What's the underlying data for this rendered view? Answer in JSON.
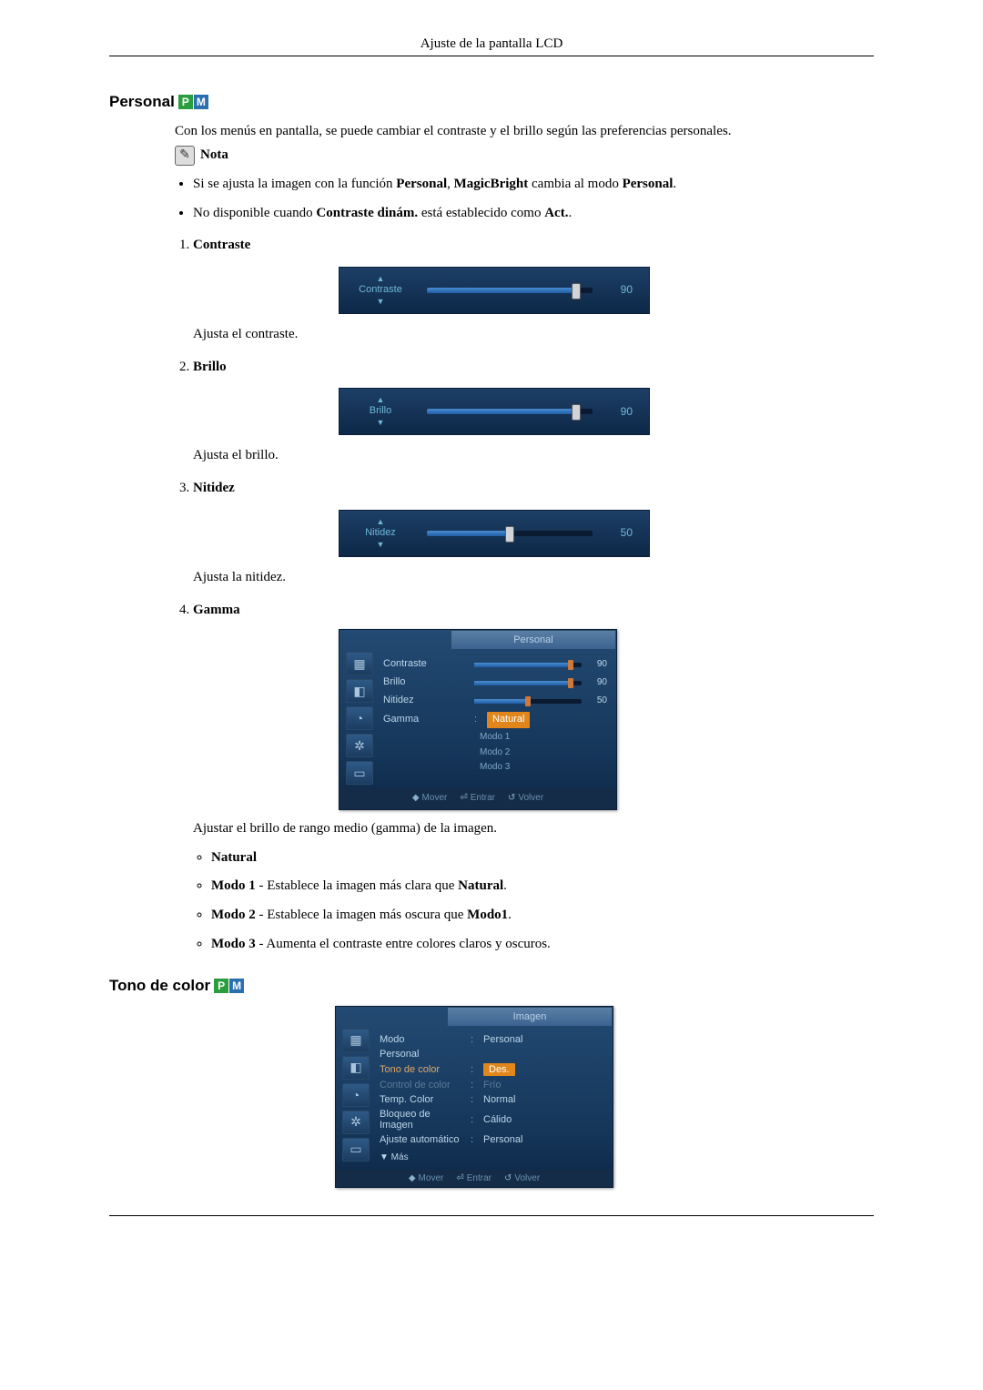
{
  "page_header": "Ajuste de la pantalla LCD",
  "pm_badge": {
    "p": "P",
    "m": "M"
  },
  "personal": {
    "title": "Personal",
    "intro": "Con los menús en pantalla, se puede cambiar el contraste y el brillo según las preferencias personales.",
    "note_label": "Nota",
    "bullet1": {
      "p1": "Si se ajusta la imagen con la función ",
      "b1": "Personal",
      "p2": ", ",
      "b2": "MagicBright",
      "p3": " cambia al modo ",
      "b3": "Personal",
      "p4": "."
    },
    "bullet2": {
      "p1": "No disponible cuando ",
      "b1": "Contraste dinám.",
      "p2": " está establecido como ",
      "b2": "Act.",
      "p3": "."
    },
    "items": [
      {
        "title": "Contraste",
        "slider_label": "Contraste",
        "value": 90,
        "fill_pct": 90,
        "desc": "Ajusta el contraste."
      },
      {
        "title": "Brillo",
        "slider_label": "Brillo",
        "value": 90,
        "fill_pct": 90,
        "desc": "Ajusta el brillo."
      },
      {
        "title": "Nitidez",
        "slider_label": "Nitidez",
        "value": 50,
        "fill_pct": 50,
        "desc": "Ajusta la nitidez."
      },
      {
        "title": "Gamma",
        "desc": "Ajustar el brillo de rango medio (gamma) de la imagen."
      }
    ],
    "gamma_menu": {
      "tab": "Personal",
      "rows": [
        {
          "label": "Contraste",
          "value": 90
        },
        {
          "label": "Brillo",
          "value": 90
        },
        {
          "label": "Nitidez",
          "value": 50
        }
      ],
      "gamma_label": "Gamma",
      "options": [
        "Natural",
        "Modo 1",
        "Modo 2",
        "Modo 3"
      ],
      "selected": "Natural",
      "footer": {
        "move": "Mover",
        "enter": "Entrar",
        "return": "Volver"
      }
    },
    "gamma_bullets": {
      "natural": "Natural",
      "m1": {
        "b": "Modo 1",
        "t1": " - Establece la imagen más clara que ",
        "b2": "Natural",
        "t2": "."
      },
      "m2": {
        "b": "Modo 2",
        "t1": " - Establece la imagen más oscura que ",
        "b2": "Modo1",
        "t2": "."
      },
      "m3": {
        "b": "Modo 3",
        "t": " - Aumenta el contraste entre colores claros y oscuros."
      }
    }
  },
  "tono": {
    "title": "Tono de color",
    "menu": {
      "tab": "Imagen",
      "rows": [
        {
          "label": "Modo",
          "value": "Personal"
        },
        {
          "label": "Personal"
        },
        {
          "label": "Tono de color",
          "highlight": "Des."
        },
        {
          "label": "Control de color",
          "disabled": true
        },
        {
          "label": "Temp. Color"
        },
        {
          "label": "Bloqueo de Imagen"
        },
        {
          "label": "Ajuste automático"
        }
      ],
      "options": [
        "Frío",
        "Normal",
        "Cálido",
        "Personal"
      ],
      "more": "▼ Más",
      "footer": {
        "move": "Mover",
        "enter": "Entrar",
        "return": "Volver"
      }
    }
  }
}
